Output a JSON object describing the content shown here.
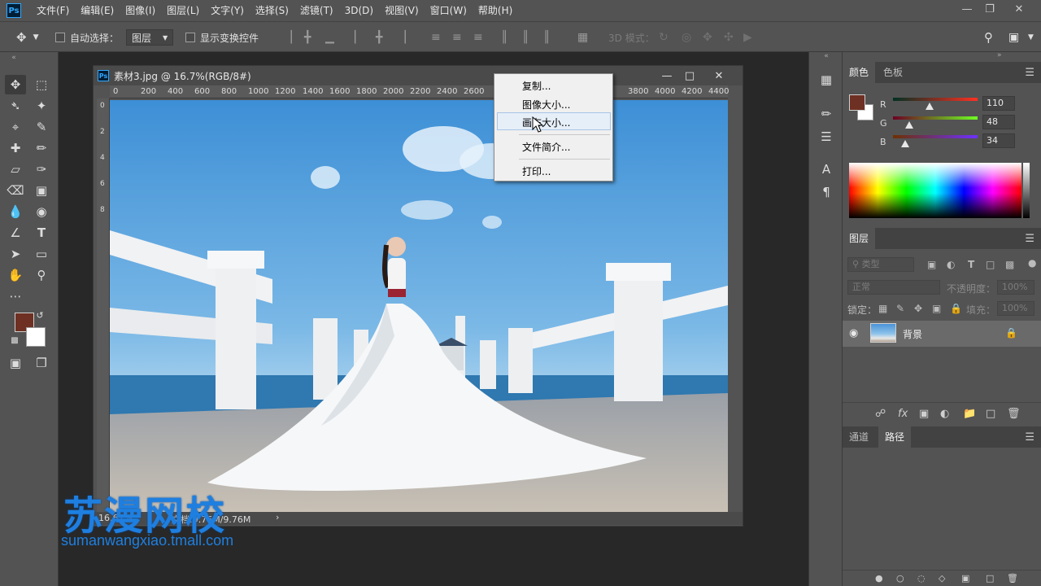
{
  "app": {
    "logo": "Ps",
    "menus": [
      "文件(F)",
      "编辑(E)",
      "图像(I)",
      "图层(L)",
      "文字(Y)",
      "选择(S)",
      "滤镜(T)",
      "3D(D)",
      "视图(V)",
      "窗口(W)",
      "帮助(H)"
    ]
  },
  "options": {
    "auto_select_label": "自动选择：",
    "auto_select_value": "图层",
    "show_transform_label": "显示变换控件",
    "mode_3d_label": "3D 模式："
  },
  "document": {
    "title": "素材3.jpg @ 16.7%(RGB/8#)",
    "ruler_h": [
      "0",
      "200",
      "400",
      "600",
      "800",
      "1000",
      "1200",
      "1400",
      "1600",
      "1800",
      "2000",
      "2200",
      "2400",
      "2600",
      "3800",
      "4000",
      "4200",
      "4400"
    ],
    "ruler_v": [
      "0",
      "2",
      "4",
      "6",
      "8"
    ],
    "status_zoom": "16.67%",
    "status_doc": "文档:9.76M/9.76M"
  },
  "context_menu": {
    "items": [
      "复制...",
      "图像大小...",
      "画布大小...",
      "文件简介...",
      "打印..."
    ],
    "highlighted": "画布大小..."
  },
  "color_panel": {
    "tabs": [
      "颜色",
      "色板"
    ],
    "active_tab": "颜色",
    "foreground": "#6e3022",
    "background": "#ffffff",
    "channels": [
      {
        "label": "R",
        "value": "110"
      },
      {
        "label": "G",
        "value": "48"
      },
      {
        "label": "B",
        "value": "34"
      }
    ]
  },
  "layers_panel": {
    "title": "图层",
    "filter_placeholder": "类型",
    "blend_mode": "正常",
    "opacity_label": "不透明度：",
    "opacity_value": "100%",
    "lock_label": "锁定：",
    "fill_label": "填充：",
    "fill_value": "100%",
    "layers": [
      {
        "name": "背景",
        "visible": true,
        "locked": true
      }
    ]
  },
  "channels_panel": {
    "tabs": [
      "通道",
      "路径"
    ],
    "active_tab": "路径"
  },
  "watermark": {
    "brand": "苏漫网校",
    "url": "sumanwangxiao.tmall.com"
  }
}
